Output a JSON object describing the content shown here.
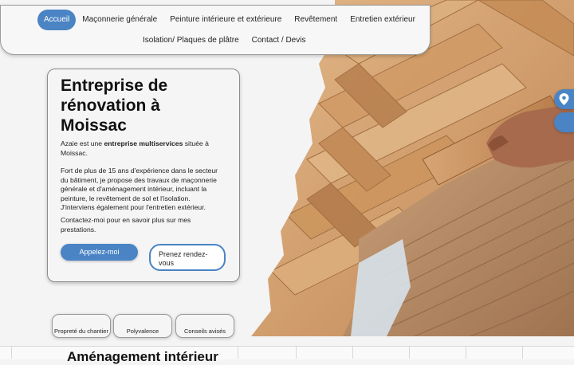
{
  "nav": {
    "items": [
      {
        "label": "Accueil",
        "active": true
      },
      {
        "label": "Maçonnerie générale"
      },
      {
        "label": "Peinture intérieure et extérieure"
      },
      {
        "label": "Revêtement"
      },
      {
        "label": "Entretien extérieur"
      },
      {
        "label": "Isolation/ Plaques de plâtre"
      },
      {
        "label": "Contact / Devis"
      }
    ]
  },
  "hero": {
    "title": "Entreprise de rénovation à Moissac",
    "intro_before": "Azaie est une ",
    "intro_bold": "entreprise multiservices",
    "intro_after": " située à Moissac.",
    "paragraph2": "Fort de plus de 15 ans d'expérience dans le secteur du bâtiment, je propose des travaux de maçonnerie générale et d'aménagement intérieur, incluant la peinture, le revêtement de sol et l'isolation. J'interviens également pour l'entretien extérieur.",
    "paragraph3": " Contactez-moi pour en savoir plus sur mes prestations.",
    "call_button": "Appelez-moi",
    "rdv_button": "Prenez rendez-vous"
  },
  "features": [
    {
      "label": "Propreté du chantier"
    },
    {
      "label": "Polyvalence"
    },
    {
      "label": "Conseils avisés"
    }
  ],
  "next_section": {
    "title": "Aménagement intérieur"
  },
  "icons": {
    "location": "location-pin-icon"
  },
  "colors": {
    "accent": "#4a84c4",
    "wood": "#c9935c",
    "adhesive": "#b88a60"
  }
}
